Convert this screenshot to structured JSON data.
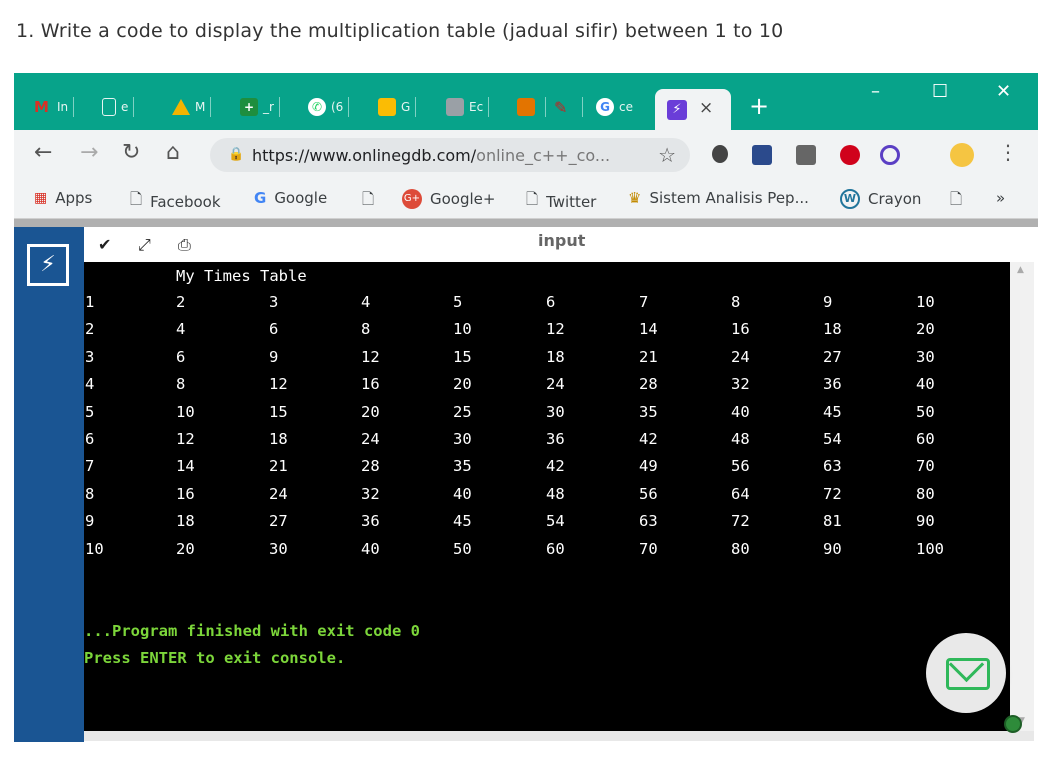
{
  "question": "1. Write a code to display the multiplication table (jadual sifir) between 1 to 10",
  "browser": {
    "tabs": [
      {
        "label": "In",
        "icon": "gmail-icon",
        "color": "#d93025"
      },
      {
        "label": "e",
        "icon": "document-icon",
        "color": "#e6f5f2"
      },
      {
        "label": "M",
        "icon": "google-drive-icon",
        "color": "#f4b400"
      },
      {
        "label": "_r",
        "icon": "cross-icon",
        "color": "#1e8e3e"
      },
      {
        "label": "(6",
        "icon": "whatsapp-icon",
        "color": "#25d366"
      },
      {
        "label": "G",
        "icon": "keep-icon",
        "color": "#fbbc04"
      },
      {
        "label": "Ec",
        "icon": "doc-icon",
        "color": "#9aa0a6"
      },
      {
        "label": "",
        "icon": "box-icon",
        "color": "#e37400"
      },
      {
        "label": "",
        "icon": "pen-icon",
        "color": "#c5221f"
      },
      {
        "label": "ce",
        "icon": "google-icon",
        "color": "#4285f4"
      }
    ],
    "active_tab_close": "×",
    "new_tab": "+",
    "minimize": "–",
    "maximize": "☐",
    "close": "✕",
    "url_main": "https://www.onlinegdb.com/",
    "url_rest": "online_c++_co...",
    "bookmarks": [
      {
        "label": "Apps",
        "icon": "apps-icon"
      },
      {
        "label": "Facebook",
        "icon": "page-icon"
      },
      {
        "label": "Google",
        "icon": "google-icon"
      },
      {
        "label": "",
        "icon": "page-icon"
      },
      {
        "label": "Google+",
        "icon": "google-plus-icon"
      },
      {
        "label": "Twitter",
        "icon": "page-icon"
      },
      {
        "label": "Sistem Analisis Pep...",
        "icon": "crest-icon"
      },
      {
        "label": "Crayon",
        "icon": "wordpress-icon"
      },
      {
        "label": "",
        "icon": "page-icon"
      }
    ],
    "more_bookmarks": "»"
  },
  "editor": {
    "input_label": "input"
  },
  "console": {
    "title": "My Times Table",
    "table": [
      [
        "1",
        "2",
        "3",
        "4",
        "5",
        "6",
        "7",
        "8",
        "9",
        "10"
      ],
      [
        "2",
        "4",
        "6",
        "8",
        "10",
        "12",
        "14",
        "16",
        "18",
        "20"
      ],
      [
        "3",
        "6",
        "9",
        "12",
        "15",
        "18",
        "21",
        "24",
        "27",
        "30"
      ],
      [
        "4",
        "8",
        "12",
        "16",
        "20",
        "24",
        "28",
        "32",
        "36",
        "40"
      ],
      [
        "5",
        "10",
        "15",
        "20",
        "25",
        "30",
        "35",
        "40",
        "45",
        "50"
      ],
      [
        "6",
        "12",
        "18",
        "24",
        "30",
        "36",
        "42",
        "48",
        "54",
        "60"
      ],
      [
        "7",
        "14",
        "21",
        "28",
        "35",
        "42",
        "49",
        "56",
        "63",
        "70"
      ],
      [
        "8",
        "16",
        "24",
        "32",
        "40",
        "48",
        "56",
        "64",
        "72",
        "80"
      ],
      [
        "9",
        "18",
        "27",
        "36",
        "45",
        "54",
        "63",
        "72",
        "81",
        "90"
      ],
      [
        "10",
        "20",
        "30",
        "40",
        "50",
        "60",
        "70",
        "80",
        "90",
        "100"
      ]
    ],
    "finished": "...Program finished with exit code 0",
    "press_enter": "Press ENTER to exit console.",
    "text_color": "#ffffff",
    "status_color": "#7cd63a"
  }
}
